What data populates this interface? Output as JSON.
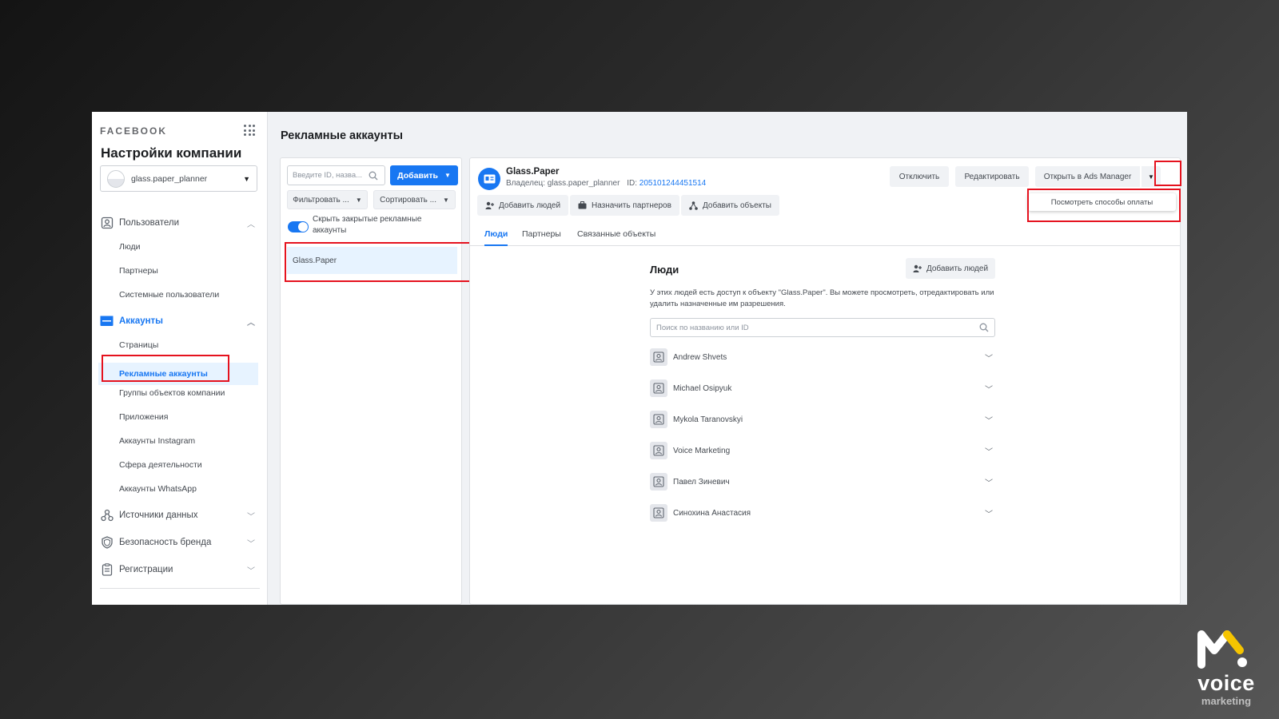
{
  "sidebar": {
    "brand": "FACEBOOK",
    "company_title": "Настройки компании",
    "account_selector": "glass.paper_planner",
    "sections": [
      {
        "label": "Пользователи",
        "icon": "users-icon",
        "expanded": true,
        "items": [
          "Люди",
          "Партнеры",
          "Системные пользователи"
        ]
      },
      {
        "label": "Аккаунты",
        "icon": "accounts-icon",
        "expanded": true,
        "items": [
          "Страницы",
          "Рекламные аккаунты",
          "Группы объектов компании",
          "Приложения",
          "Аккаунты Instagram",
          "Сфера деятельности",
          "Аккаунты WhatsApp"
        ]
      },
      {
        "label": "Источники данных",
        "icon": "data-sources-icon",
        "expanded": false
      },
      {
        "label": "Безопасность бренда",
        "icon": "shield-icon",
        "expanded": false
      },
      {
        "label": "Регистрации",
        "icon": "registration-icon",
        "expanded": false
      }
    ],
    "selected_item": "Рекламные аккаунты"
  },
  "header": {
    "title": "Рекламные аккаунты"
  },
  "list_panel": {
    "search_placeholder": "Введите ID, назва...",
    "add_button": "Добавить",
    "filter_button": "Фильтровать ...",
    "sort_button": "Сортировать ...",
    "toggle_label": "Скрыть закрытые рекламные аккаунты",
    "toggle_on": true,
    "items": [
      "Glass.Paper"
    ]
  },
  "detail": {
    "account_name": "Glass.Paper",
    "owner_prefix": "Владелец: glass.paper_planner",
    "id_prefix": "ID:",
    "account_id": "205101244451514",
    "buttons": {
      "disable": "Отключить",
      "edit": "Редактировать",
      "open_ads_manager": "Открыть в Ads Manager"
    },
    "dropdown_item": "Посмотреть способы оплаты",
    "actions": {
      "add_people": "Добавить людей",
      "assign_partners": "Назначить партнеров",
      "add_objects": "Добавить объекты"
    },
    "tabs": [
      "Люди",
      "Партнеры",
      "Связанные объекты"
    ],
    "active_tab": "Люди",
    "people_section": {
      "title": "Люди",
      "add_button": "Добавить людей",
      "description": "У этих людей есть доступ к объекту \"Glass.Paper\". Вы можете просмотреть, отредактировать или удалить назначенные им разрешения.",
      "search_placeholder": "Поиск по названию или ID",
      "people": [
        "Andrew Shvets",
        "Michael Osipyuk",
        "Mykola Taranovskyi",
        "Voice Marketing",
        "Павел Зиневич",
        "Синохина Анастасия"
      ]
    }
  },
  "brand_logo": {
    "word": "voice",
    "subword": "marketing",
    "accent_color": "#f5c400"
  },
  "colors": {
    "accent": "#1877f2",
    "highlight_red": "#e5121e"
  }
}
